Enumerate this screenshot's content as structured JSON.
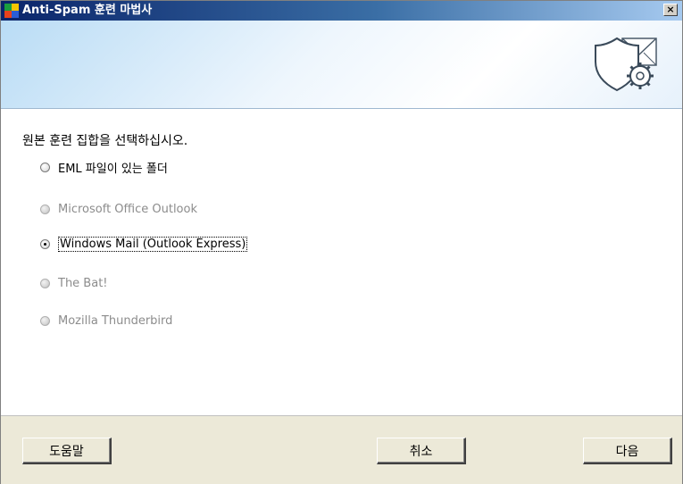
{
  "window": {
    "title": "Anti-Spam 훈련 마법사",
    "close_glyph": "×"
  },
  "content": {
    "prompt": "원본 훈련 집합을 선택하십시오.",
    "options": [
      {
        "label": "EML 파일이 있는 폴더",
        "enabled": true,
        "checked": false
      },
      {
        "label": "Microsoft Office Outlook",
        "enabled": false,
        "checked": false
      },
      {
        "label": "Windows Mail (Outlook Express)",
        "enabled": true,
        "checked": true
      },
      {
        "label": "The Bat!",
        "enabled": false,
        "checked": false
      },
      {
        "label": "Mozilla Thunderbird",
        "enabled": false,
        "checked": false
      }
    ]
  },
  "footer": {
    "help_label": "도움말",
    "cancel_label": "취소",
    "next_label": "다음"
  },
  "icons": {
    "app": "avg-logo-icon",
    "banner": "shield-envelope-gear-icon"
  },
  "colors": {
    "titlebar_start": "#0a246a",
    "titlebar_end": "#a6caf0",
    "banner_accent": "#b9dcf5",
    "footer_bg": "#ece9d8",
    "disabled_text": "#8c8c8c"
  }
}
